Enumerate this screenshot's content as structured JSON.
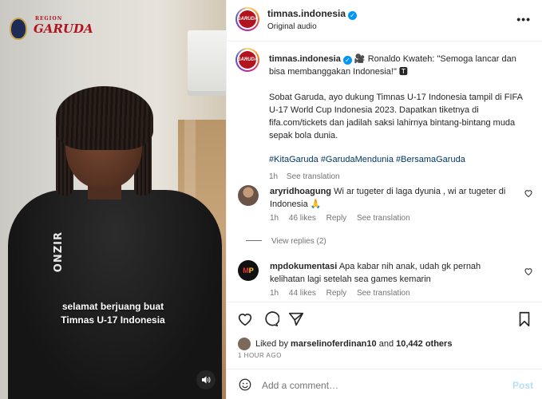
{
  "video": {
    "logo_text": "GARUDA",
    "logo_small": "REGION",
    "shirt_brand": "ONZIR",
    "caption_line1": "selamat berjuang buat",
    "caption_line2": "Timnas U-17 Indonesia",
    "mute_icon": "speaker-icon"
  },
  "header": {
    "username": "timnas.indonesia",
    "verified": "✓",
    "subtitle": "Original audio",
    "more": "•••"
  },
  "post_caption": {
    "username": "timnas.indonesia",
    "verified": "✓",
    "title_emoji": "🎥",
    "title": "Ronaldo Kwateh: \"Semoga lancar dan bisa membanggakan Indonesia!\" 🆃",
    "body": "Sobat Garuda, ayo dukung Timnas U-17 Indonesia tampil di FIFA U-17 World Cup Indonesia 2023. Dapatkan tiketnya di fifa.com/tickets dan jadilah saksi lahirnya bintang-bintang muda sepak bola dunia.",
    "hashtags": "#KitaGaruda #GarudaMendunia #BersamaGaruda",
    "time": "1h",
    "see_translation": "See translation"
  },
  "comments": [
    {
      "username": "aryridhoagung",
      "text": "Wi ar tugeter di laga dyunia , wi ar tugeter di Indonesia 🙏",
      "time": "1h",
      "likes": "46 likes",
      "reply": "Reply",
      "see_translation": "See translation",
      "view_replies": "View replies (2)"
    },
    {
      "username": "mpdokumentasi",
      "text": "Apa kabar nih anak, udah gk pernah kelihatan lagi setelah sea games kemarin",
      "time": "1h",
      "likes": "44 likes",
      "reply": "Reply",
      "see_translation": "See translation"
    }
  ],
  "liked_by": {
    "prefix": "Liked by",
    "user": "marselinoferdinan10",
    "and": "and",
    "others": "10,442 others"
  },
  "timestamp": "1 HOUR AGO",
  "add_comment": {
    "placeholder": "Add a comment…",
    "post_label": "Post"
  },
  "colors": {
    "link": "#00376b",
    "verified": "#0095f6",
    "post_disabled": "#b2dffc",
    "brand_red": "#b3121f"
  }
}
